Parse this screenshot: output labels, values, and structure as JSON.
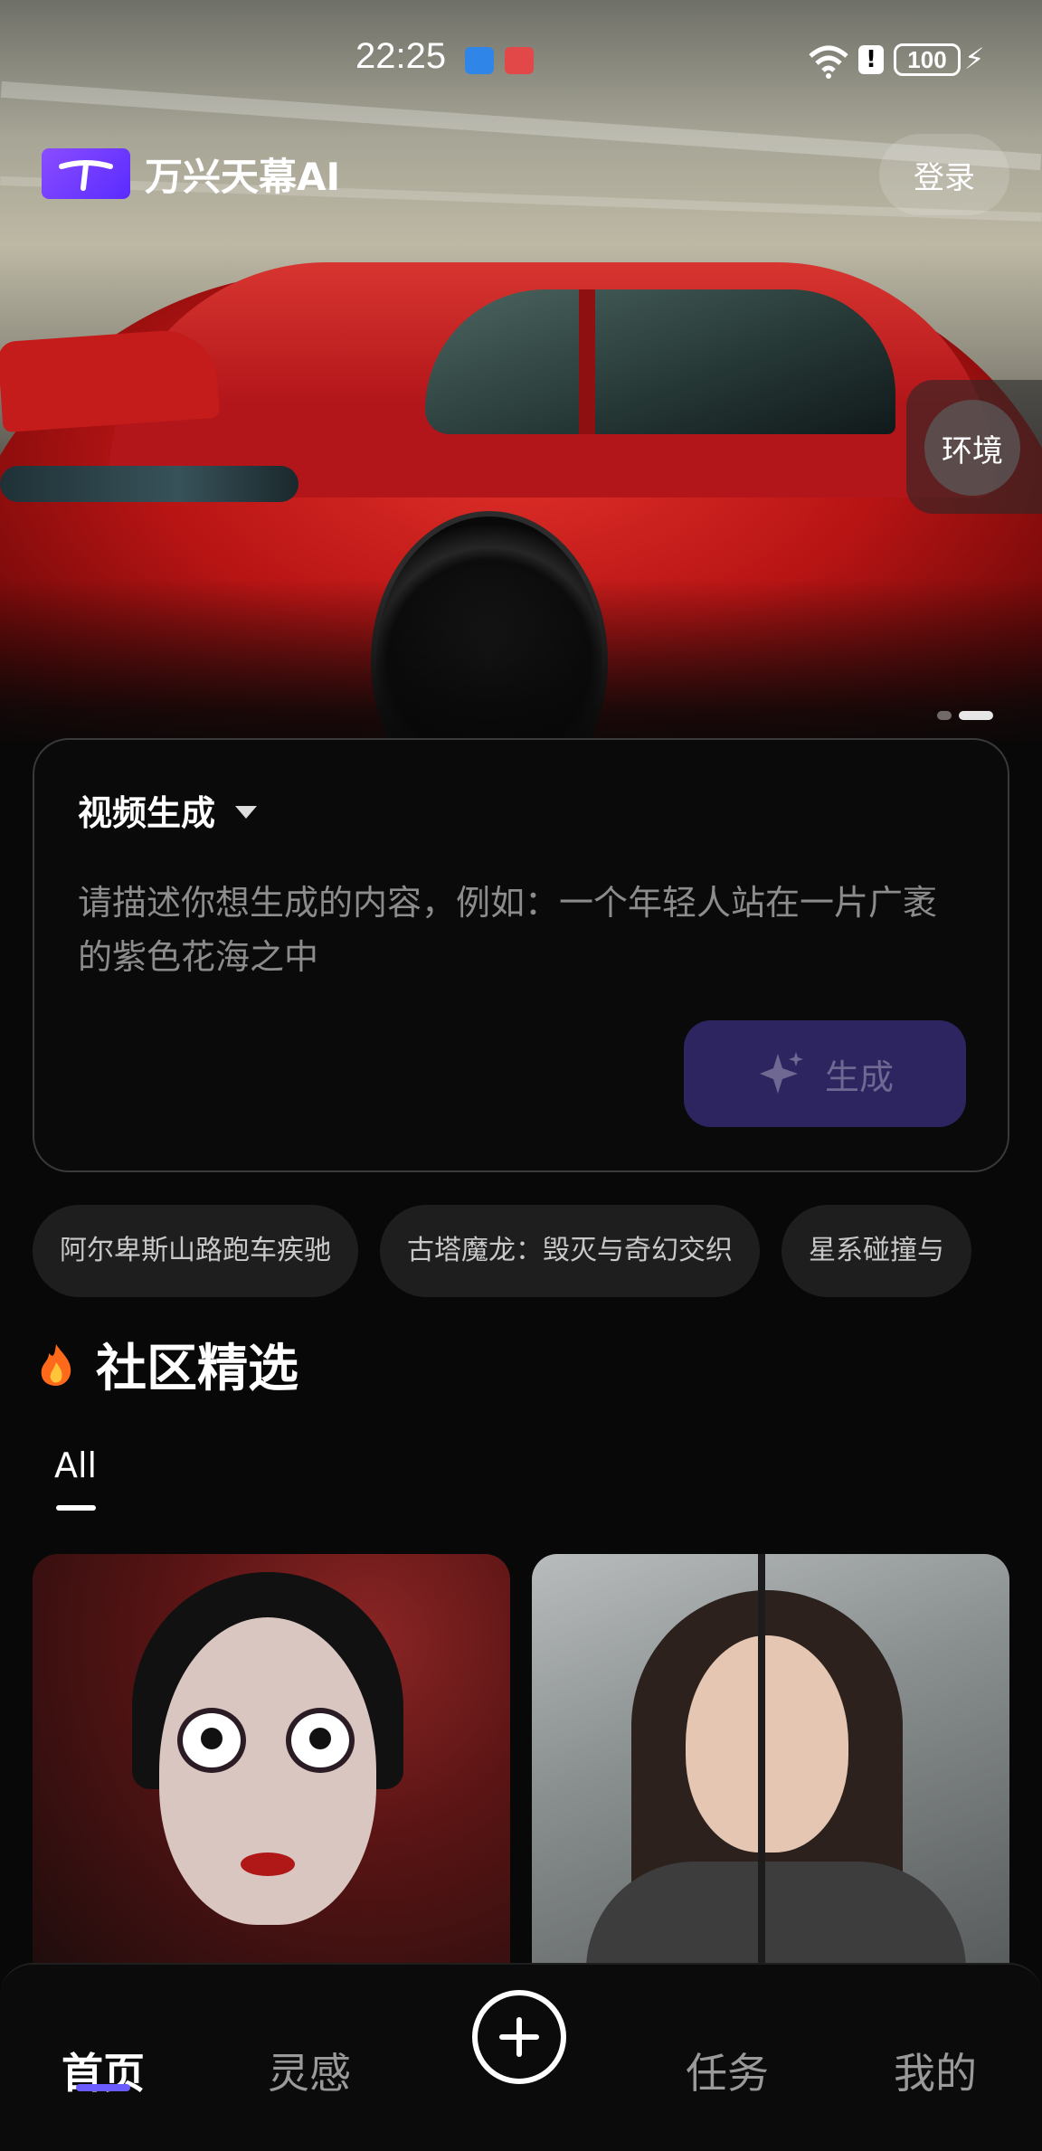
{
  "status_bar": {
    "time": "22:25",
    "battery": "100"
  },
  "header": {
    "app_name": "万兴天幕AI",
    "login_label": "登录"
  },
  "hero": {
    "tag_label": "环境"
  },
  "prompt_card": {
    "mode_label": "视频生成",
    "placeholder": "请描述你想生成的内容，例如：一个年轻人站在一片广袤的紫色花海之中",
    "generate_label": "生成"
  },
  "suggestions": [
    "阿尔卑斯山路跑车疾驰",
    "古塔魔龙：毁灭与奇幻交织",
    "星系碰撞与"
  ],
  "community": {
    "title": "社区精选",
    "tabs": [
      "All"
    ]
  },
  "bottom_nav": {
    "items": [
      "首页",
      "灵感",
      "任务",
      "我的"
    ],
    "active": "首页"
  },
  "colors": {
    "accent": "#6b5cff",
    "generate_bg": "#2c2560",
    "background": "#080808"
  },
  "icons": [
    "wifi-icon",
    "alert-icon",
    "battery-icon",
    "sparkle-icon",
    "fire-icon",
    "plus-circle-icon",
    "caret-down-icon"
  ]
}
